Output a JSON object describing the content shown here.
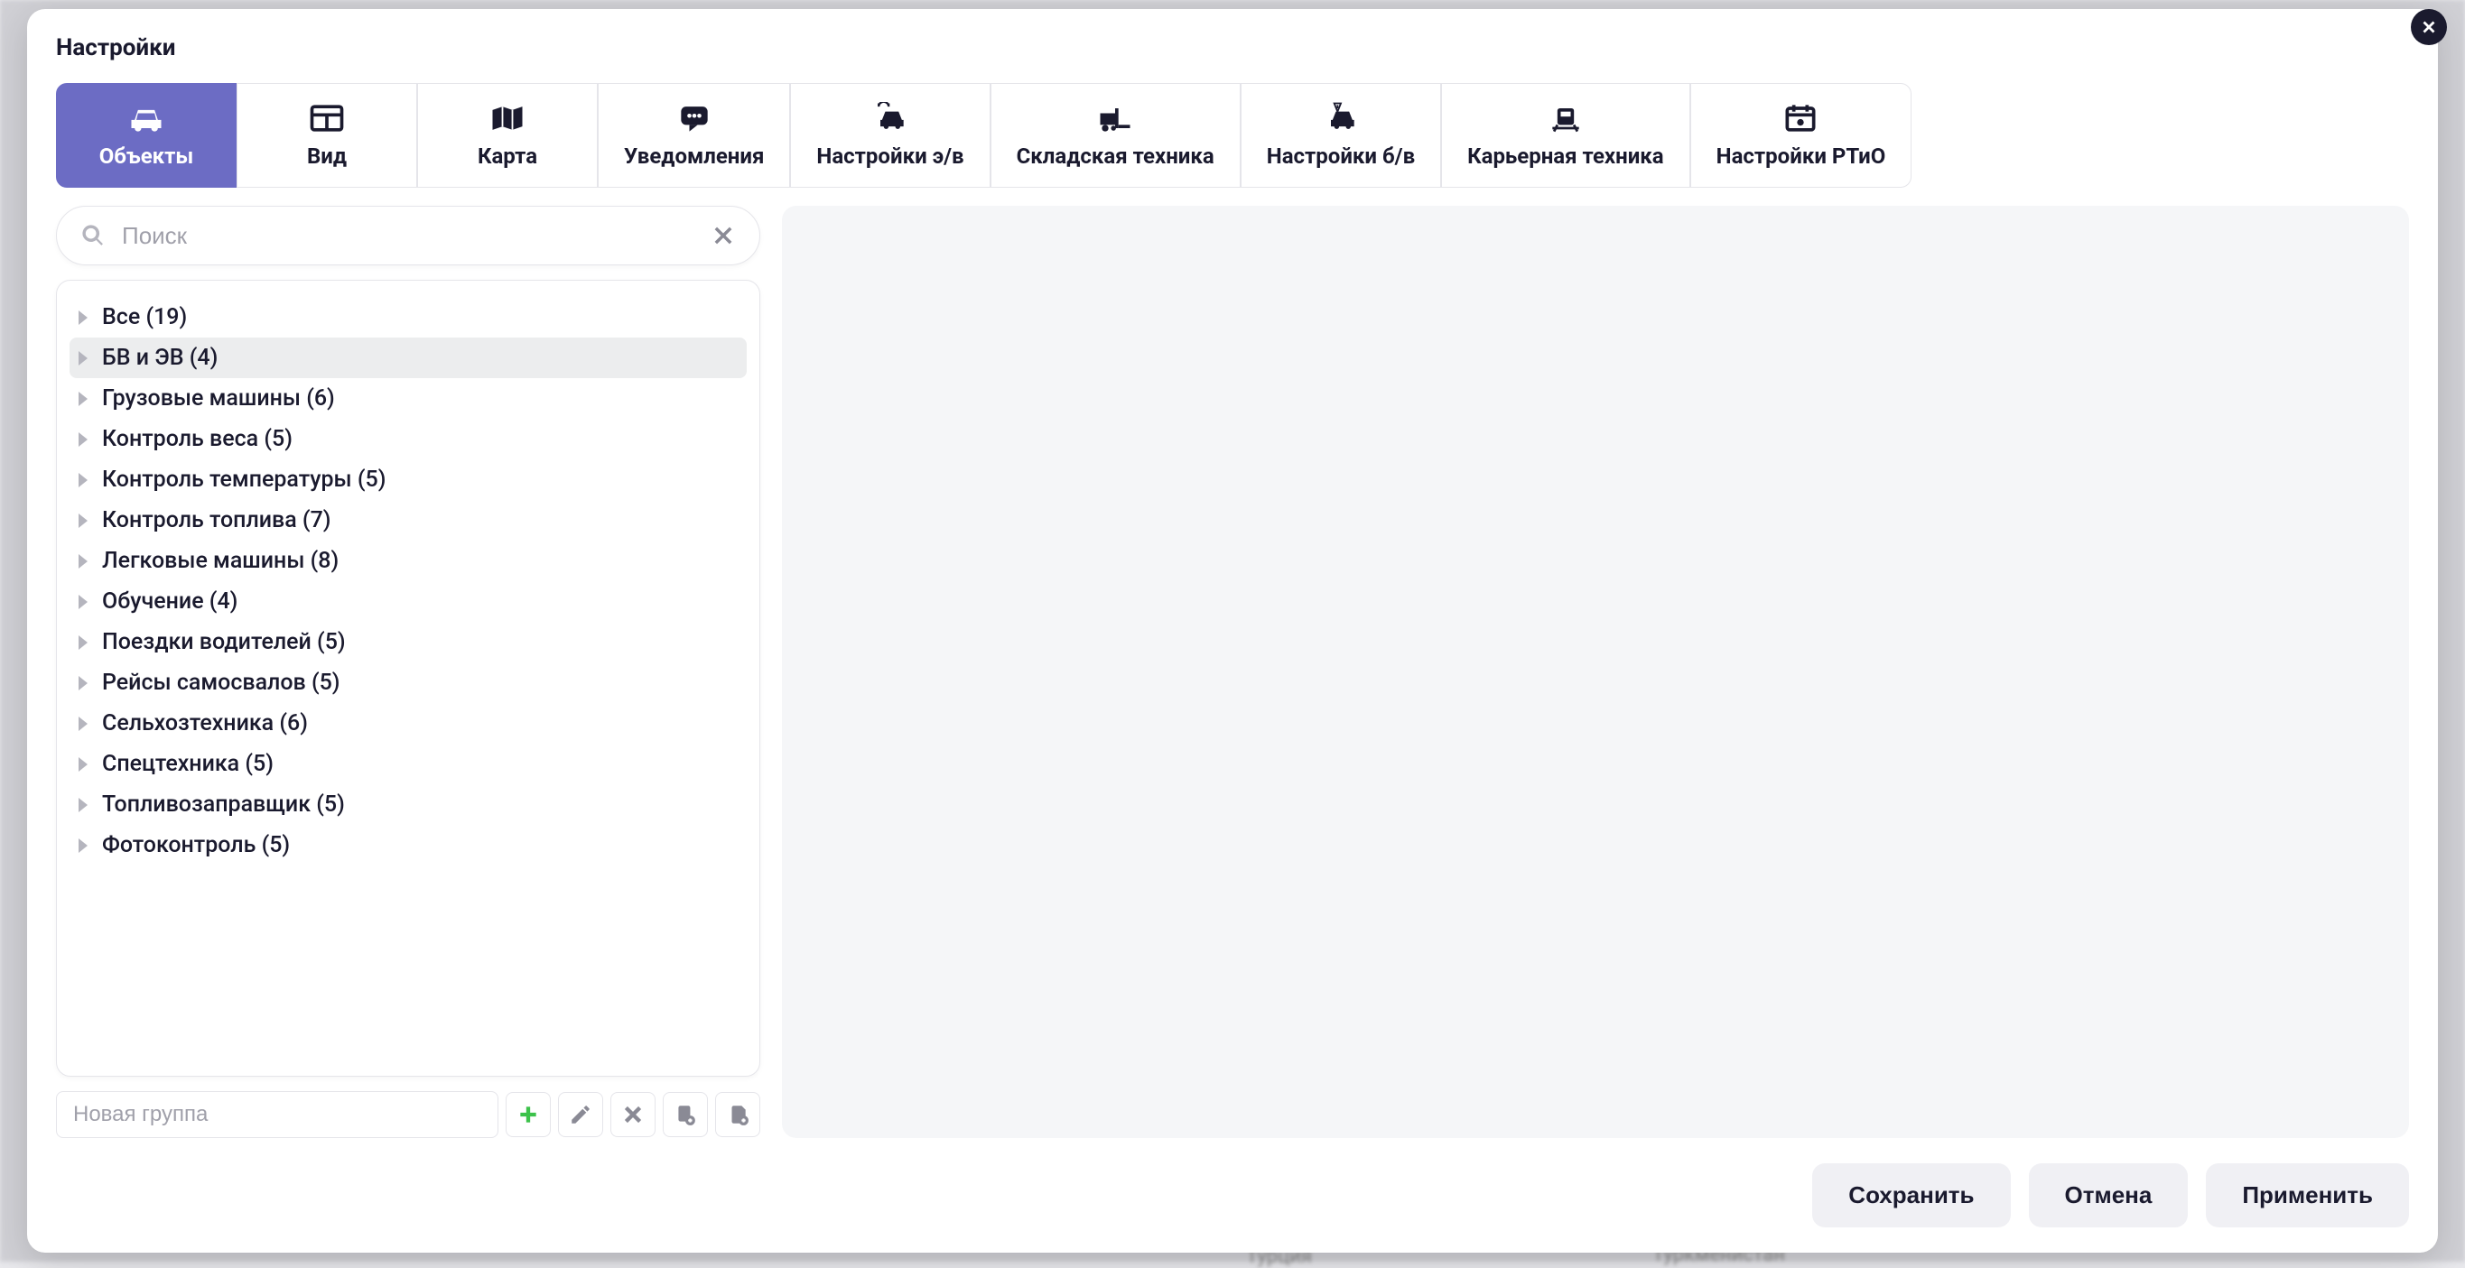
{
  "modal": {
    "title": "Настройки"
  },
  "tabs": [
    {
      "label": "Объекты",
      "active": true
    },
    {
      "label": "Вид",
      "active": false
    },
    {
      "label": "Карта",
      "active": false
    },
    {
      "label": "Уведомления",
      "active": false
    },
    {
      "label": "Настройки э/в",
      "active": false
    },
    {
      "label": "Складская техника",
      "active": false
    },
    {
      "label": "Настройки б/в",
      "active": false
    },
    {
      "label": "Карьерная техника",
      "active": false
    },
    {
      "label": "Настройки РТиО",
      "active": false
    }
  ],
  "search": {
    "placeholder": "Поиск",
    "value": ""
  },
  "tree": [
    {
      "label": "Все (19)",
      "selected": false
    },
    {
      "label": "БВ и ЭВ (4)",
      "selected": true
    },
    {
      "label": "Грузовые машины (6)",
      "selected": false
    },
    {
      "label": "Контроль веса (5)",
      "selected": false
    },
    {
      "label": "Контроль температуры (5)",
      "selected": false
    },
    {
      "label": "Контроль топлива (7)",
      "selected": false
    },
    {
      "label": "Легковые машины (8)",
      "selected": false
    },
    {
      "label": "Обучение (4)",
      "selected": false
    },
    {
      "label": "Поездки водителей (5)",
      "selected": false
    },
    {
      "label": "Рейсы самосвалов (5)",
      "selected": false
    },
    {
      "label": "Сельхозтехника (6)",
      "selected": false
    },
    {
      "label": "Спецтехника (5)",
      "selected": false
    },
    {
      "label": "Топливозаправщик (5)",
      "selected": false
    },
    {
      "label": "Фотоконтроль (5)",
      "selected": false
    }
  ],
  "group_input": {
    "placeholder": "Новая группа",
    "value": ""
  },
  "footer": {
    "save": "Сохранить",
    "cancel": "Отмена",
    "apply": "Применить"
  },
  "backdrop": {
    "t1": "Турция",
    "t2": "Туркменистан"
  }
}
